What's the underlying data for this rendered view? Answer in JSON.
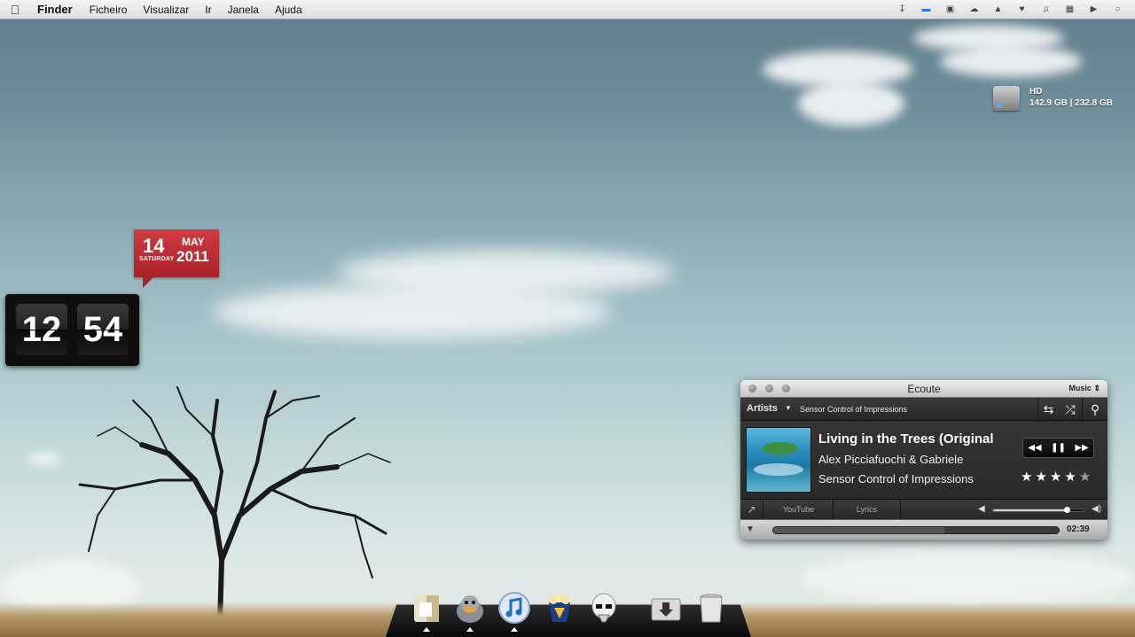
{
  "menubar": {
    "app_name": "Finder",
    "menus": [
      "Ficheiro",
      "Visualizar",
      "Ir",
      "Janela",
      "Ajuda"
    ],
    "status_icons": [
      "download-icon",
      "chat-icon",
      "cube-icon",
      "cloud-icon",
      "hat-icon",
      "heart-icon",
      "music-note-icon",
      "grid-icon",
      "volume-icon",
      "spotlight-icon"
    ]
  },
  "hd_widget": {
    "name": "HD",
    "usage": "142.9 GB  |  232.8 GB"
  },
  "calendar_widget": {
    "day": "14",
    "weekday": "SATURDAY",
    "month": "MAY",
    "year": "2011"
  },
  "clock_widget": {
    "hour": "12",
    "minute": "54"
  },
  "ecoute": {
    "title": "Ecoute",
    "source": "Music",
    "browse_label": "Artists",
    "album_selected": "Sensor Control of Impressions",
    "track_title": "Living in the Trees (Original",
    "artist": "Alex Picciafuochi & Gabriele",
    "album": "Sensor Control of Impressions",
    "rating": 4,
    "rating_max": 5,
    "tabs": [
      "YouTube",
      "Lyrics"
    ],
    "volume": 0.82,
    "progress": 0.6,
    "time": "02:39",
    "accent": "#2b2b2b"
  },
  "dock": {
    "items": [
      {
        "name": "finder-icon",
        "running": true
      },
      {
        "name": "adium-duck-icon",
        "running": true
      },
      {
        "name": "itunes-icon",
        "running": true
      },
      {
        "name": "popcorn-icon",
        "running": false
      },
      {
        "name": "stormtrooper-icon",
        "running": false
      },
      {
        "name": "downloads-folder-icon",
        "running": false
      },
      {
        "name": "trash-icon",
        "running": false
      }
    ]
  }
}
